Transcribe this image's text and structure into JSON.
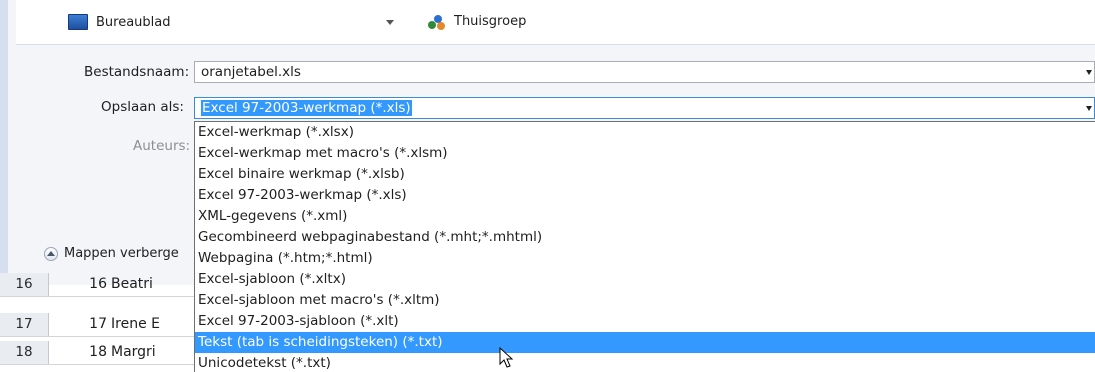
{
  "nav": {
    "desktop_label": "Bureaublad",
    "homegroup_label": "Thuisgroep"
  },
  "form": {
    "filename_label": "Bestandsnaam:",
    "filename_value": "oranjetabel.xls",
    "saveas_label": "Opslaan als:",
    "saveas_value": "Excel 97-2003-werkmap (*.xls)",
    "authors_label": "Auteurs:",
    "hide_folders_label": "Mappen verberge"
  },
  "dropdown": {
    "options": [
      "Excel-werkmap (*.xlsx)",
      "Excel-werkmap met macro's (*.xlsm)",
      "Excel binaire werkmap (*.xlsb)",
      "Excel 97-2003-werkmap (*.xls)",
      "XML-gegevens (*.xml)",
      "Gecombineerd webpaginabestand (*.mht;*.mhtml)",
      "Webpagina (*.htm;*.html)",
      "Excel-sjabloon (*.xltx)",
      "Excel-sjabloon met macro's (*.xltm)",
      "Excel 97-2003-sjabloon (*.xlt)",
      "Tekst (tab is scheidingsteken) (*.txt)",
      "Unicodetekst (*.txt)"
    ],
    "selected_index": 10
  },
  "sheet": {
    "rows": [
      {
        "header": "16",
        "num": "16",
        "text": "Beatri"
      },
      {
        "header": "17",
        "num": "17",
        "text": "Irene E"
      },
      {
        "header": "18",
        "num": "18",
        "text": "Margri"
      }
    ]
  },
  "colors": {
    "selection": "#3399ff",
    "dialog_bg": "#f3f5f9",
    "row_header_bg": "#e9edf2"
  }
}
